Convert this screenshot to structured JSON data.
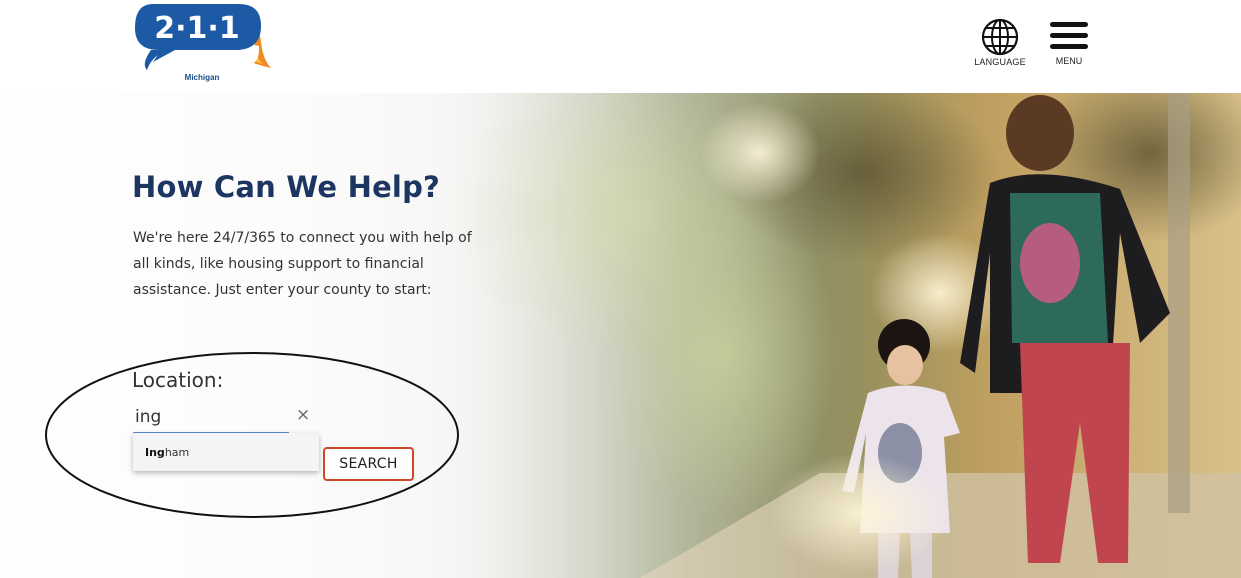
{
  "header": {
    "logo": {
      "number": "2·1·1",
      "sub": "Michigan"
    },
    "language_label": "LANGUAGE",
    "menu_label": "MENU"
  },
  "hero": {
    "title": "How Can We Help?",
    "description": "We're here 24/7/365 to connect you with help of all kinds, like housing support to financial assistance. Just enter your county to start:",
    "location_label": "Location:",
    "search": {
      "value": "ing",
      "clear_symbol": "×",
      "button_label": "SEARCH"
    },
    "suggestion": {
      "match": "Ing",
      "rest": "ham"
    }
  },
  "colors": {
    "brand_blue": "#1c5aa6",
    "title_navy": "#1c3661",
    "button_border": "#d1472b",
    "input_underline": "#5b8ad6",
    "logo_orange": "#f08a23",
    "logo_yellow": "#f6c343"
  },
  "icons": {
    "language": "globe-icon",
    "menu": "hamburger-menu-icon",
    "clear": "close-icon"
  }
}
